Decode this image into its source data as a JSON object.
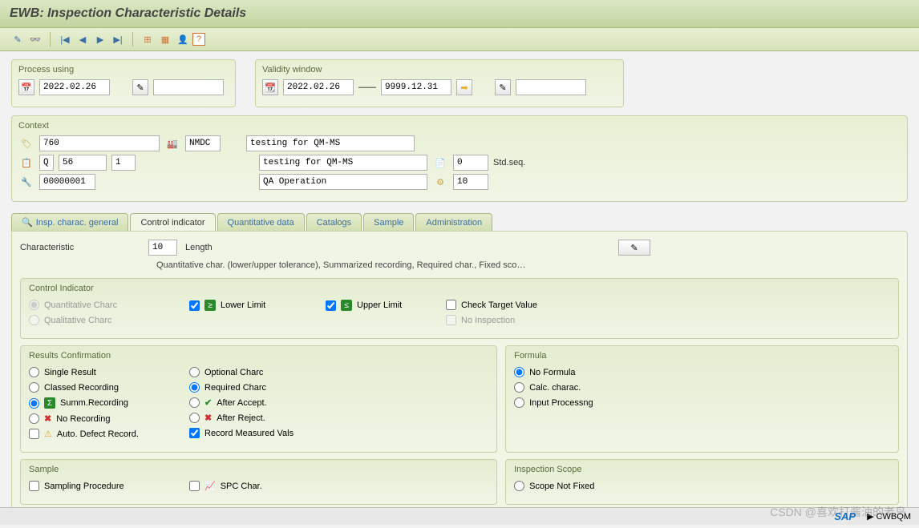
{
  "title": "EWB: Inspection Characteristic Details",
  "process_using": {
    "label": "Process using",
    "date": "2022.02.26"
  },
  "validity": {
    "label": "Validity window",
    "from": "2022.02.26",
    "to": "9999.12.31"
  },
  "context": {
    "label": "Context",
    "code": "760",
    "plant": "NMDC",
    "desc1": "testing for QM-MS",
    "q": "Q",
    "seq1": "56",
    "seq2": "1",
    "desc2": "testing for QM-MS",
    "num0": "0",
    "stdseq": "Std.seq.",
    "op": "00000001",
    "opdesc": "QA Operation",
    "val10": "10"
  },
  "tabs": {
    "t1": "Insp. charac. general",
    "t2": "Control indicator",
    "t3": "Quantitative data",
    "t4": "Catalogs",
    "t5": "Sample",
    "t6": "Administration"
  },
  "char": {
    "label": "Characteristic",
    "num": "10",
    "name": "Length",
    "longdesc": "Quantitative char. (lower/upper tolerance), Summarized recording, Required char., Fixed sco…"
  },
  "ctrl": {
    "title": "Control Indicator",
    "quant": "Quantitative Charc",
    "qual": "Qualitative Charc",
    "lower": "Lower Limit",
    "upper": "Upper Limit",
    "chktgt": "Check Target Value",
    "noinsp": "No Inspection"
  },
  "results": {
    "title": "Results Confirmation",
    "single": "Single Result",
    "classed": "Classed Recording",
    "summ": "Summ.Recording",
    "norec": "No Recording",
    "autodef": "Auto. Defect Record.",
    "optional": "Optional Charc",
    "required": "Required Charc",
    "afteracc": "After Accept.",
    "afterrej": "After Reject.",
    "recmeas": "Record Measured Vals"
  },
  "formula": {
    "title": "Formula",
    "nof": "No Formula",
    "calc": "Calc. charac.",
    "input": "Input Processng"
  },
  "sample": {
    "title": "Sample",
    "sampproc": "Sampling Procedure",
    "spc": "SPC Char."
  },
  "scope": {
    "title": "Inspection Scope",
    "notfixed": "Scope Not Fixed"
  },
  "status": {
    "system": "CWBQM"
  },
  "watermark": "CSDN @喜欢打酱油的老鸟"
}
